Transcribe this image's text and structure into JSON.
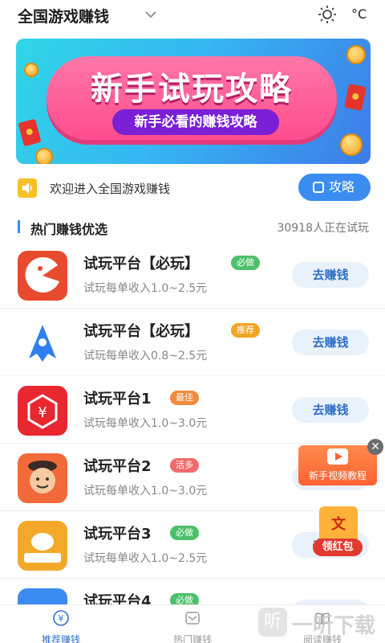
{
  "header": {
    "title": "全国游戏赚钱",
    "temperature": "°C",
    "icons": [
      "chevron-down-icon",
      "sun-icon"
    ]
  },
  "banner": {
    "title": "新手试玩攻略",
    "subtitle": "新手必看的赚钱攻略",
    "active_slide": 1,
    "slides": 2,
    "colors": {
      "background": "#36b7f2",
      "pill": "#ff4c8d",
      "sub_pill": "#7a1fd6"
    }
  },
  "notice": {
    "text": "欢迎进入全国游戏赚钱",
    "button_label": "攻略"
  },
  "section": {
    "title": "热门赚钱优选",
    "count_text": "30918人正在试玩"
  },
  "list": [
    {
      "name": "试玩平台【必玩】",
      "badge": "必做",
      "badge_color": "#4cc06b",
      "desc": "试玩每单收入1.0~2.5元",
      "button": "去赚钱",
      "icon": "pacman-app-icon",
      "icon_color": "#e84a2e"
    },
    {
      "name": "试玩平台【必玩】",
      "badge": "推荐",
      "badge_color": "#f2a524",
      "desc": "试玩每单收入0.8~2.5元",
      "button": "去赚钱",
      "icon": "rocket-app-icon",
      "icon_color": "#ffffff"
    },
    {
      "name": "试玩平台1",
      "badge": "最佳",
      "badge_color": "#f08a3c",
      "desc": "试玩每单收入1.0~3.0元",
      "button": "去赚钱",
      "icon": "yen-app-icon",
      "icon_color": "#e8272f"
    },
    {
      "name": "试玩平台2",
      "badge": "活多",
      "badge_color": "#f06b6b",
      "desc": "试玩每单收入1.0~3.0元",
      "button": "去赚钱",
      "icon": "face-app-icon",
      "icon_color": "#f26a3a"
    },
    {
      "name": "试玩平台3",
      "badge": "必做",
      "badge_color": "#4cc06b",
      "desc": "试玩每单收入1.0~2.5元",
      "button": "去赚钱",
      "icon": "bean-app-icon",
      "icon_color": "#f4a82a"
    },
    {
      "name": "试玩平台4",
      "badge": "必做",
      "badge_color": "#4cc06b",
      "desc": "",
      "button": "去赚钱",
      "icon": "app-icon",
      "icon_color": "#3a8cf0"
    }
  ],
  "float_video": {
    "label": "新手视频教程"
  },
  "float_red": {
    "label": "领红包",
    "glyph": "文"
  },
  "bottom_nav": [
    {
      "label": "推荐赚钱",
      "icon": "yen-circle-icon",
      "active": true
    },
    {
      "label": "热门赚钱",
      "icon": "inbox-icon",
      "active": false
    },
    {
      "label": "阅读赚钱",
      "icon": "book-icon",
      "active": false
    }
  ],
  "watermark": {
    "text": "一听下载",
    "glyph": "听"
  }
}
